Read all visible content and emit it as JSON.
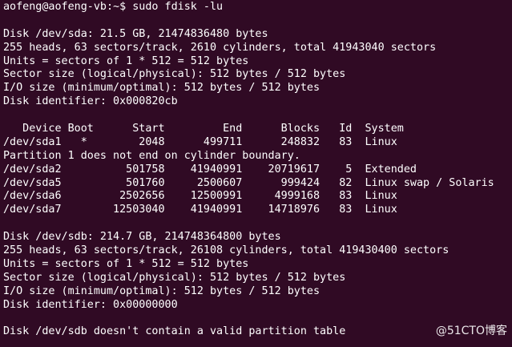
{
  "prompt": {
    "user_host_path": "aofeng@aofeng-vb:~$",
    "command": " sudo fdisk -lu"
  },
  "disk_sda": {
    "summary": "Disk /dev/sda: 21.5 GB, 21474836480 bytes",
    "geometry": "255 heads, 63 sectors/track, 2610 cylinders, total 41943040 sectors",
    "units": "Units = sectors of 1 * 512 = 512 bytes",
    "sector_size": "Sector size (logical/physical): 512 bytes / 512 bytes",
    "io_size": "I/O size (minimum/optimal): 512 bytes / 512 bytes",
    "identifier": "Disk identifier: 0x000820cb"
  },
  "partition_table": {
    "header": "   Device Boot      Start         End      Blocks   Id  System",
    "rows": [
      "/dev/sda1   *        2048      499711      248832   83  Linux",
      "Partition 1 does not end on cylinder boundary.",
      "/dev/sda2          501758    41940991    20719617    5  Extended",
      "/dev/sda5          501760     2500607      999424   82  Linux swap / Solaris",
      "/dev/sda6         2502656    12500991     4999168   83  Linux",
      "/dev/sda7        12503040    41940991    14718976   83  Linux"
    ]
  },
  "disk_sdb": {
    "summary": "Disk /dev/sdb: 214.7 GB, 214748364800 bytes",
    "geometry": "255 heads, 63 sectors/track, 26108 cylinders, total 419430400 sectors",
    "units": "Units = sectors of 1 * 512 = 512 bytes",
    "sector_size": "Sector size (logical/physical): 512 bytes / 512 bytes",
    "io_size": "I/O size (minimum/optimal): 512 bytes / 512 bytes",
    "identifier": "Disk identifier: 0x00000000",
    "warning": "Disk /dev/sdb doesn't contain a valid partition table"
  },
  "watermark": "@51CTO博客",
  "colors": {
    "background": "#300a24",
    "text": "#ffffff"
  }
}
